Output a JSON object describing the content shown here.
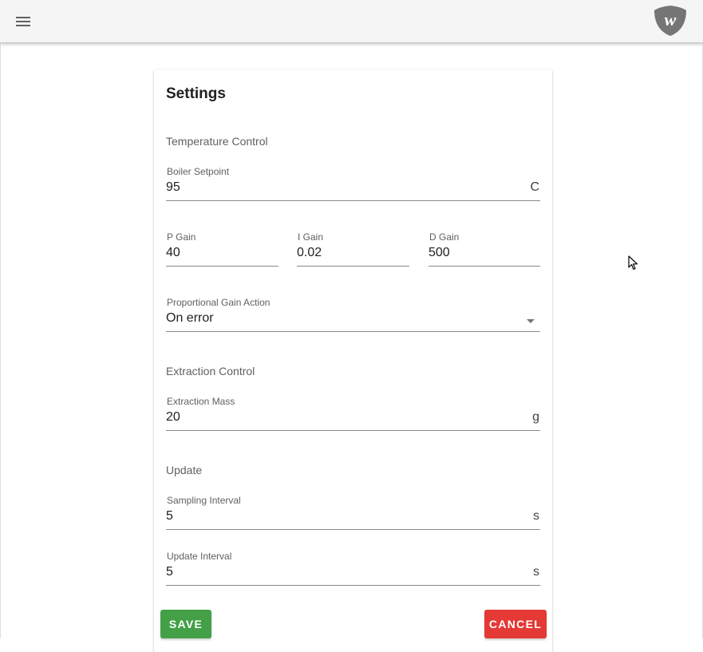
{
  "app": {
    "menu_icon": "hamburger-menu-icon",
    "logo_icon": "shield-logo-icon",
    "logo_text": "w",
    "colors": {
      "topbar": "#f5f5f5",
      "logo": "#757575"
    }
  },
  "settings": {
    "title": "Settings",
    "sections": {
      "temperature": "Temperature Control",
      "extraction": "Extraction Control",
      "update": "Update"
    },
    "boiler_setpoint": {
      "label": "Boiler Setpoint",
      "value": "95",
      "unit": "C"
    },
    "p_gain": {
      "label": "P Gain",
      "value": "40"
    },
    "i_gain": {
      "label": "I Gain",
      "value": "0.02"
    },
    "d_gain": {
      "label": "D Gain",
      "value": "500"
    },
    "proportional_gain_action": {
      "label": "Proportional Gain Action",
      "value": "On error"
    },
    "extraction_mass": {
      "label": "Extraction Mass",
      "value": "20",
      "unit": "g"
    },
    "sampling_interval": {
      "label": "Sampling Interval",
      "value": "5",
      "unit": "s"
    },
    "update_interval": {
      "label": "Update Interval",
      "value": "5",
      "unit": "s"
    }
  },
  "actions": {
    "save_label": "SAVE",
    "cancel_label": "CANCEL",
    "colors": {
      "save": "#43a047",
      "cancel": "#e53935"
    }
  }
}
